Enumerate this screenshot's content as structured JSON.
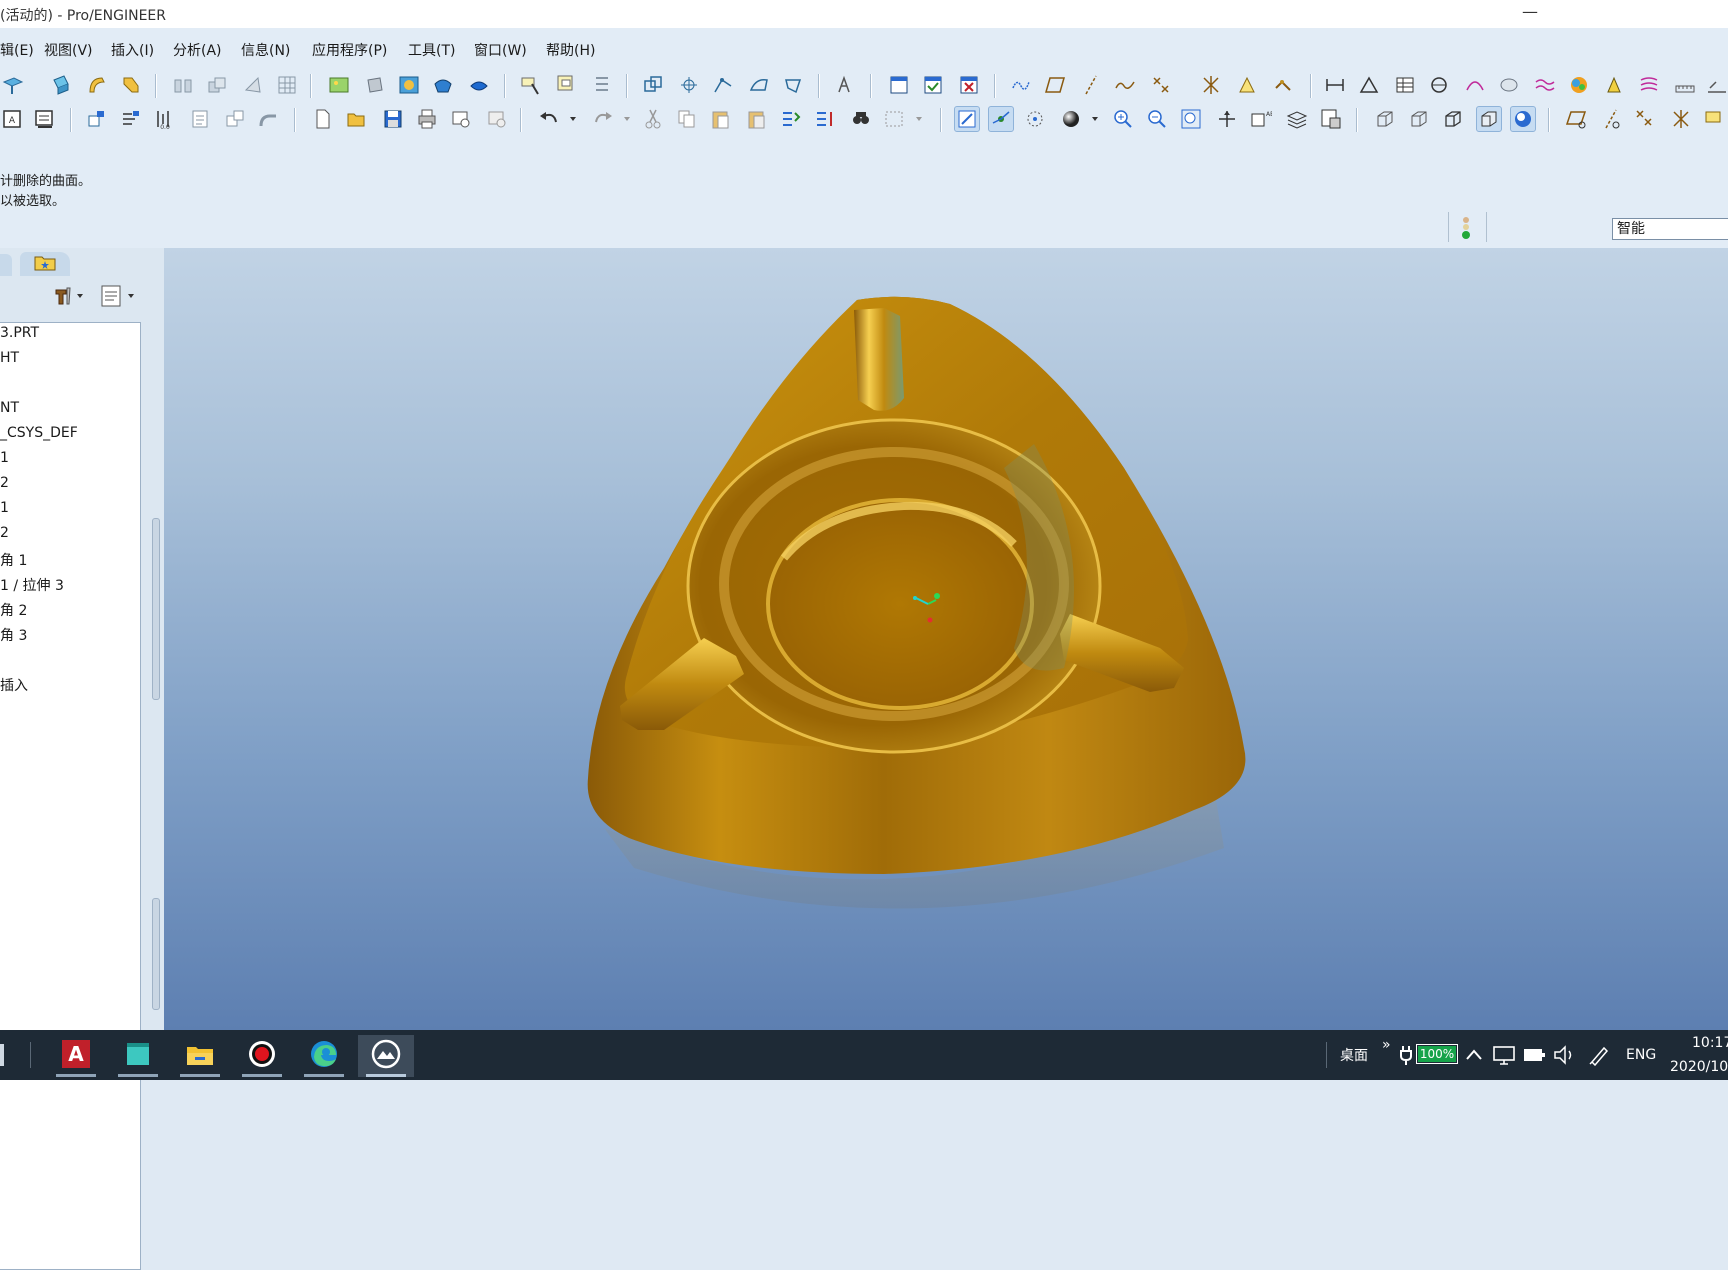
{
  "window": {
    "title": "(活动的) - Pro/ENGINEER",
    "minimize": "—"
  },
  "menu": [
    "辑(E)",
    "视图(V)",
    "插入(I)",
    "分析(A)",
    "信息(N)",
    "应用程序(P)",
    "工具(T)",
    "窗口(W)",
    "帮助(H)"
  ],
  "messages": [
    "计删除的曲面。",
    "以被选取。"
  ],
  "filter": {
    "value": "智能"
  },
  "model_tree": {
    "items": [
      "3.PRT",
      "HT",
      "",
      "NT",
      "_CSYS_DEF",
      "1",
      "2",
      "1",
      "2",
      "角 1",
      "1 / 拉伸 3",
      "角 2",
      "角 3",
      "",
      "插入"
    ]
  },
  "taskbar": {
    "apps": [
      "autocad-icon",
      "app-icon",
      "file-explorer-icon",
      "recorder-icon",
      "edge-icon",
      "proengineer-icon"
    ],
    "desktop_label": "桌面",
    "more": "»",
    "battery_percent": 100,
    "battery_label": "100%",
    "input_language": "ENG",
    "time": "10:17",
    "date": "2020/10"
  },
  "colors": {
    "model_gold": "#c08a10",
    "background_top": "#c1d3e5",
    "background_bottom": "#5d7fb1"
  }
}
